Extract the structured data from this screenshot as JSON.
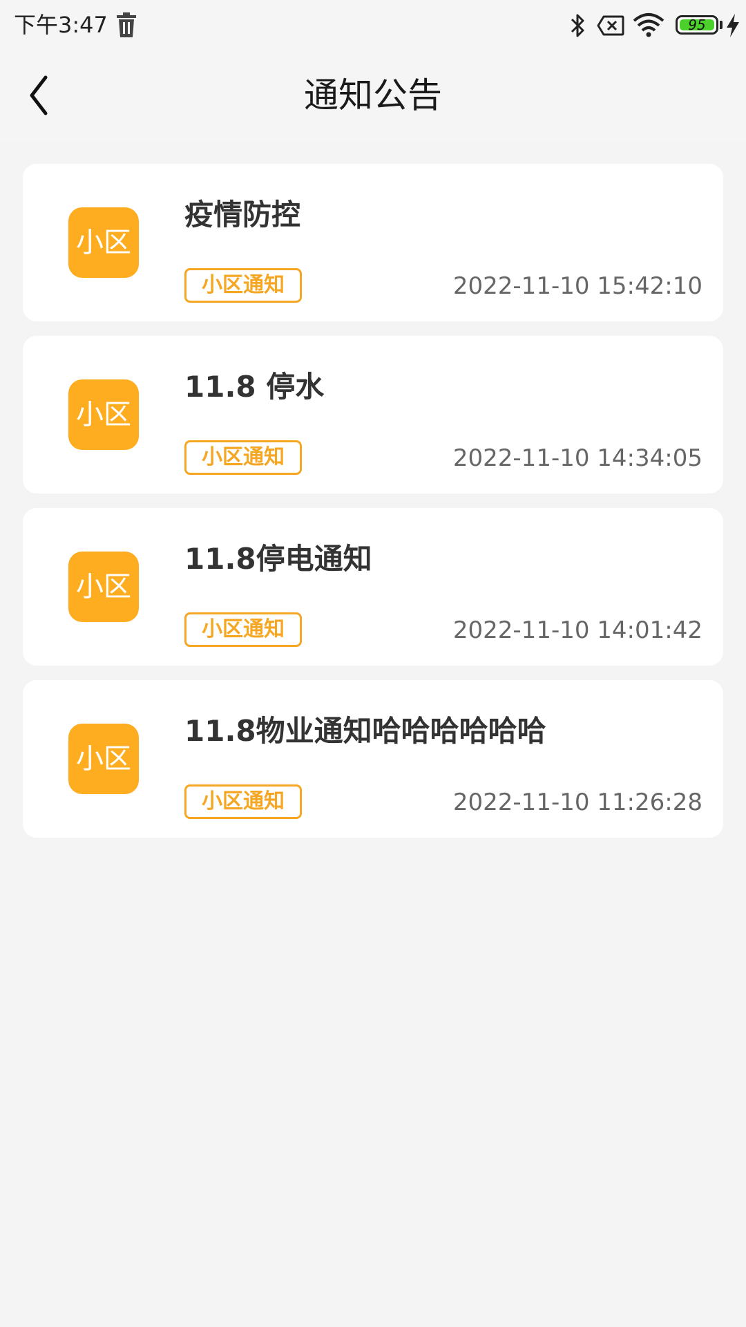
{
  "status_bar": {
    "time": "下午3:47",
    "battery_level": "95",
    "icons": [
      "trash-icon",
      "bluetooth-icon",
      "sim-disabled-icon",
      "wifi-icon",
      "battery-icon",
      "charging-icon"
    ]
  },
  "header": {
    "title": "通知公告",
    "back_icon": "chevron-left-icon"
  },
  "colors": {
    "accent": "#ffad20",
    "tag": "#f5a623",
    "title_text": "#333333",
    "time_text": "#666666",
    "background": "#f4f4f4"
  },
  "notices": [
    {
      "avatar": "小区",
      "title": "疫情防控",
      "tag": "小区通知",
      "time": "2022-11-10 15:42:10"
    },
    {
      "avatar": "小区",
      "title": "11.8 停水",
      "tag": "小区通知",
      "time": "2022-11-10 14:34:05"
    },
    {
      "avatar": "小区",
      "title": "11.8停电通知",
      "tag": "小区通知",
      "time": "2022-11-10 14:01:42"
    },
    {
      "avatar": "小区",
      "title": "11.8物业通知哈哈哈哈哈哈",
      "tag": "小区通知",
      "time": "2022-11-10 11:26:28"
    }
  ]
}
